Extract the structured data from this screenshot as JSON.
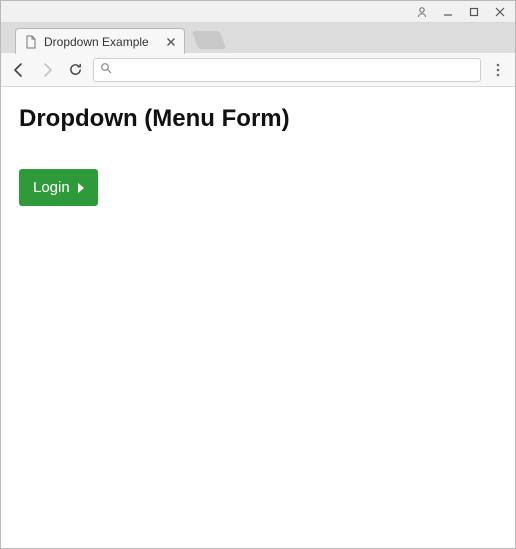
{
  "window_controls": {
    "profile": "profile",
    "minimize": "minimize",
    "maximize": "maximize",
    "close": "close"
  },
  "tab": {
    "title": "Dropdown Example"
  },
  "toolbar": {
    "address_value": "",
    "address_placeholder": ""
  },
  "page": {
    "heading": "Dropdown (Menu Form)",
    "login_label": "Login"
  }
}
